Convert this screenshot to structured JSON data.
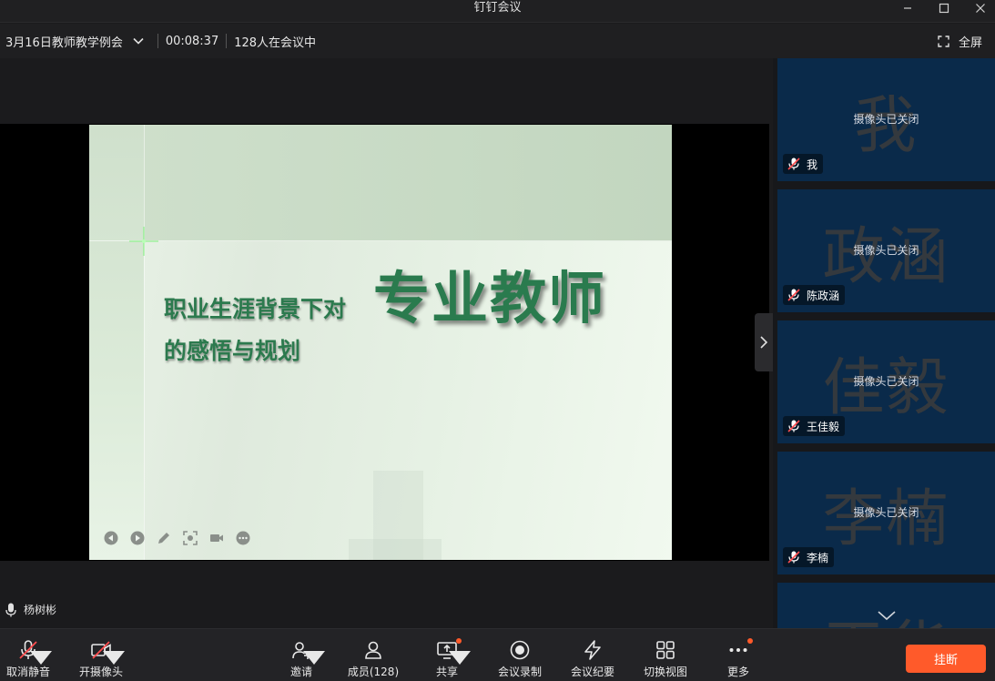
{
  "window": {
    "title": "钉钉会议",
    "controls": [
      "minimize-icon",
      "maximize-icon",
      "close-icon"
    ]
  },
  "infobar": {
    "meeting_title": "3月16日教师教学例会",
    "elapsed": "00:08:37",
    "attendees": "128人在会议中",
    "fullscreen_label": "全屏"
  },
  "slide": {
    "subtitle_line1": "职业生涯背景下对",
    "subtitle_line2": "的感悟与规划",
    "main_title": "专业教师",
    "controls": [
      "prev-slide-icon",
      "next-slide-icon",
      "pen-icon",
      "screenshot-icon",
      "camera-icon",
      "more-icon"
    ]
  },
  "speaker": {
    "name": "杨树彬"
  },
  "participants": [
    {
      "initials": "我",
      "status": "摄像头已关闭",
      "name": "我"
    },
    {
      "initials": "政涵",
      "status": "摄像头已关闭",
      "name": "陈政涵"
    },
    {
      "initials": "佳毅",
      "status": "摄像头已关闭",
      "name": "王佳毅"
    },
    {
      "initials": "李楠",
      "status": "摄像头已关闭",
      "name": "李楠"
    },
    {
      "initials": "王华",
      "status": "",
      "name": ""
    }
  ],
  "toolbar": {
    "mute": "取消静音",
    "camera": "开摄像头",
    "invite": "邀请",
    "members": "成员(128)",
    "share": "共享",
    "record": "会议录制",
    "minutes": "会议纪要",
    "view": "切换视图",
    "more": "更多",
    "hangup": "挂断"
  },
  "colors": {
    "accent": "#ff5a2a",
    "tile_bg": "#0a2a4a",
    "slide_text": "#2a7b4e"
  }
}
